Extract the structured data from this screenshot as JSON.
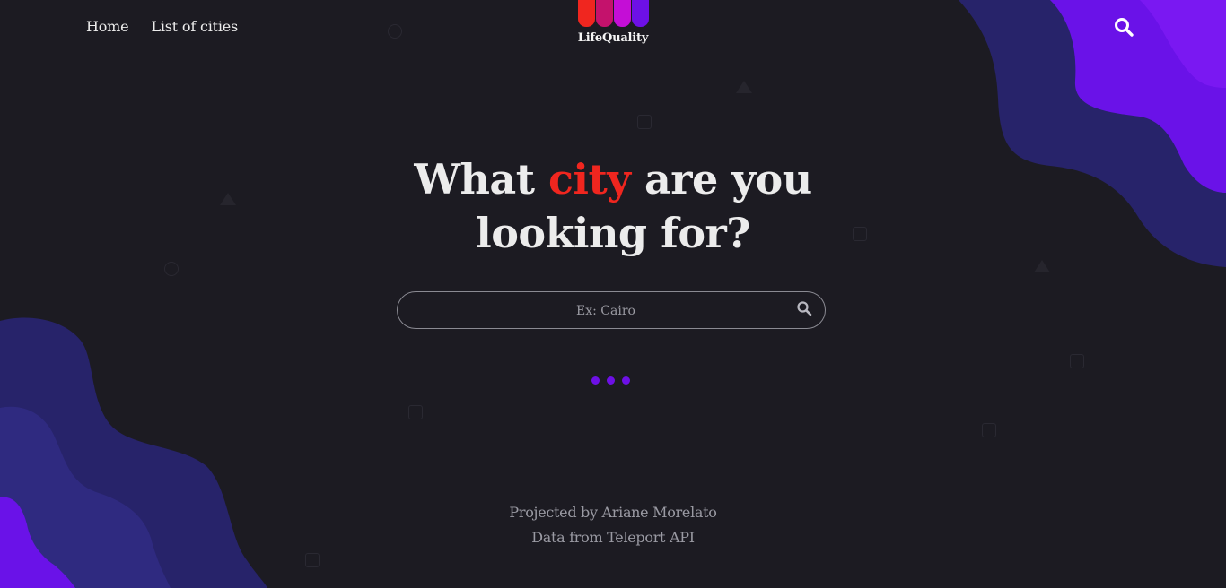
{
  "nav": {
    "links": [
      {
        "label": "Home"
      },
      {
        "label": "List of cities"
      }
    ]
  },
  "logo": {
    "text": "LifeQuality",
    "bar_colors": [
      "#f0261f",
      "#c4126c",
      "#c40ed6",
      "#6d10e6"
    ]
  },
  "hero": {
    "title_before": "What ",
    "title_accent": "city",
    "title_after": " are you looking for?",
    "accent_color": "#f0261f"
  },
  "search": {
    "placeholder": "Ex: Cairo",
    "value": "",
    "icon": "search-icon"
  },
  "loader": {
    "dot_color": "#6d10e6"
  },
  "footer": {
    "credit": "Projected by Ariane Morelato",
    "source": "Data from Teleport API"
  },
  "theme": {
    "background": "#1c1b22",
    "wave_dark": "#27236a",
    "wave_light": "#6a12e8"
  }
}
